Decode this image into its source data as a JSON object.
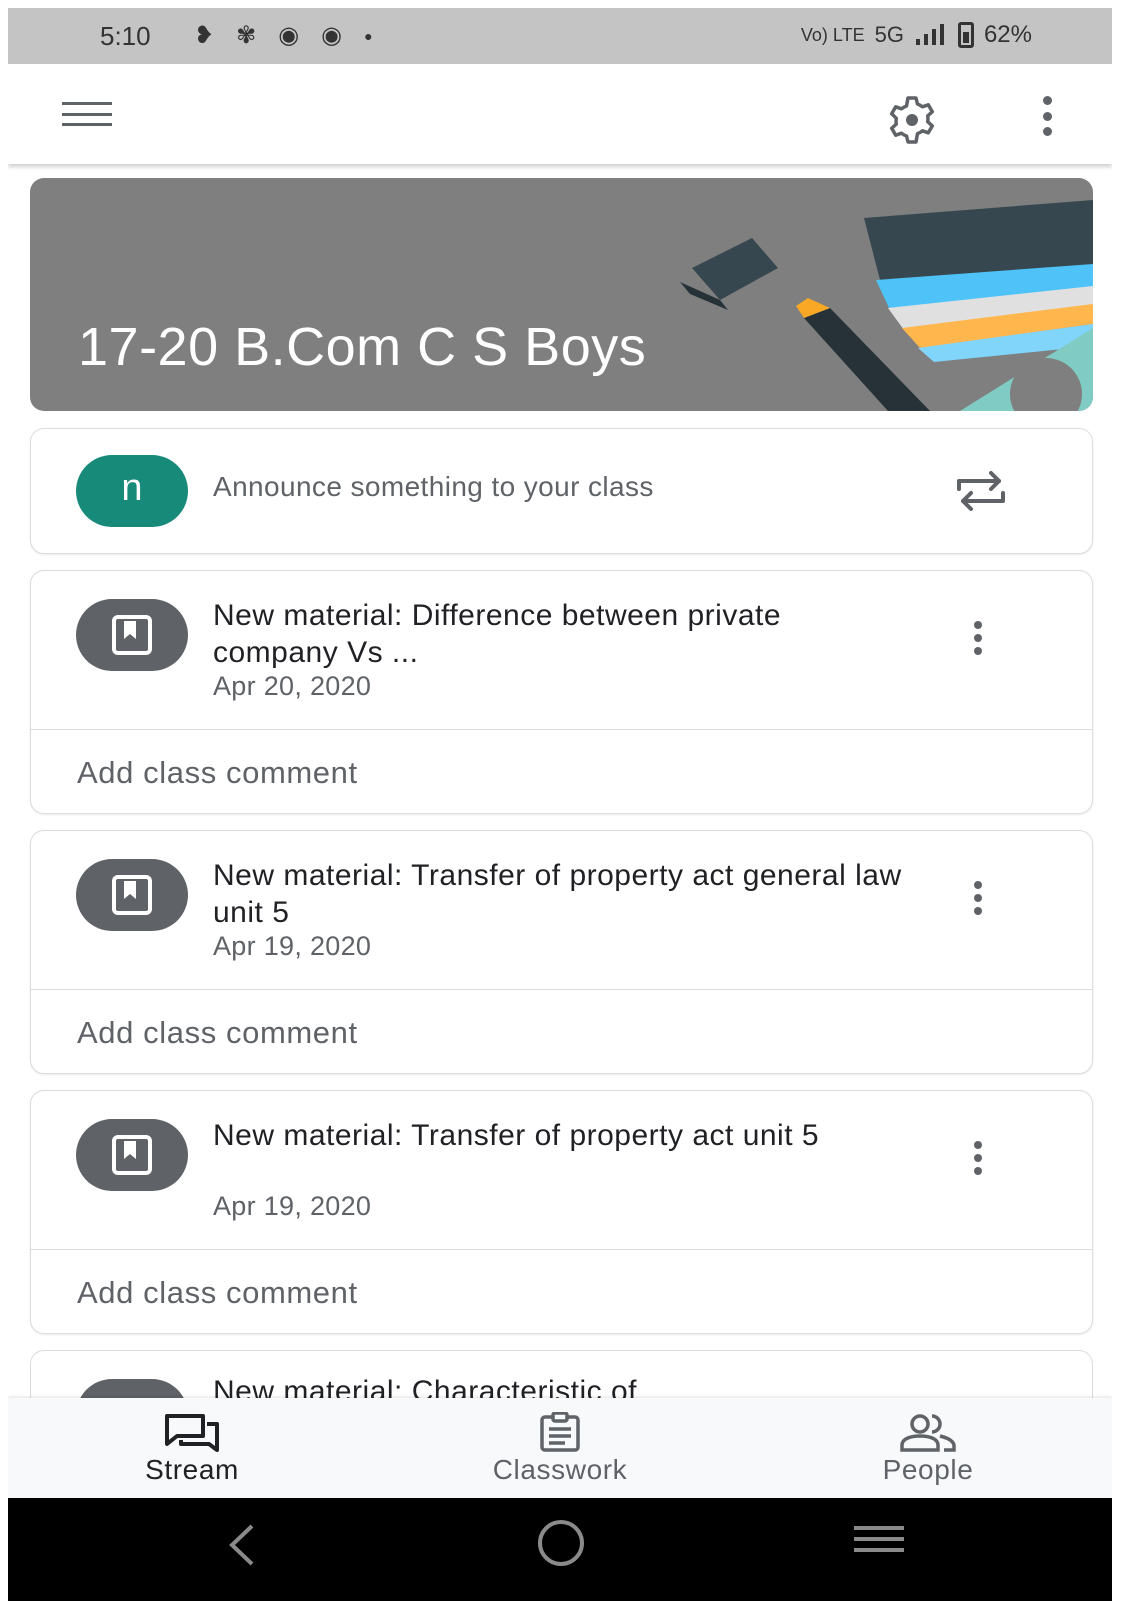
{
  "status_bar": {
    "time": "5:10",
    "network": "5G",
    "volte": "Vo) LTE",
    "battery": "62%"
  },
  "class": {
    "title": "17-20 B.Com C S Boys"
  },
  "announce": {
    "avatar_letter": "n",
    "placeholder": "Announce something to your class"
  },
  "posts": [
    {
      "title": "New material: Difference between private company Vs ...",
      "date": "Apr 20, 2020",
      "comment_label": "Add class comment"
    },
    {
      "title": "New material: Transfer of property act general law unit 5",
      "date": "Apr 19, 2020",
      "comment_label": "Add class comment"
    },
    {
      "title": "New material: Transfer of property act unit 5",
      "date": "Apr 19, 2020",
      "comment_label": "Add class comment"
    },
    {
      "title": "New material: Characteristic of"
    }
  ],
  "bottom_nav": {
    "items": [
      {
        "label": "Stream",
        "icon": "stream-icon",
        "active": true
      },
      {
        "label": "Classwork",
        "icon": "classwork-icon",
        "active": false
      },
      {
        "label": "People",
        "icon": "people-icon",
        "active": false
      }
    ]
  },
  "colors": {
    "avatar_user": "#188a7a",
    "avatar_material": "#5f6368",
    "banner": "#7f7f7f"
  }
}
